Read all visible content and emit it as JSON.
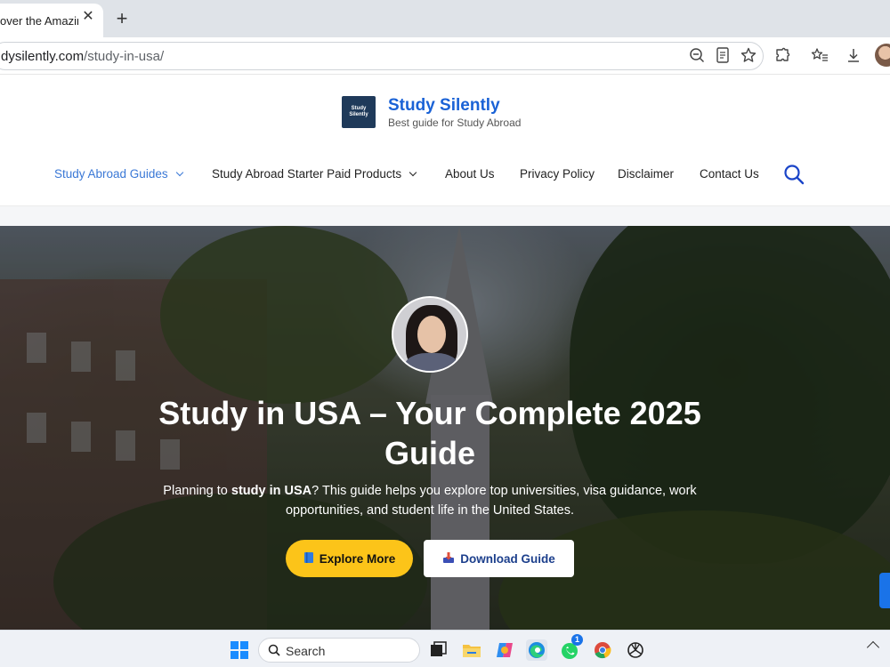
{
  "browser": {
    "tab_title": "over the Amazin",
    "url_domain": "dysilently.com",
    "url_path": "/study-in-usa/"
  },
  "site": {
    "logo_text": [
      "Study",
      "Silently"
    ],
    "title": "Study Silently",
    "tagline": "Best guide for Study Abroad"
  },
  "nav": {
    "items": [
      {
        "label": "Study Abroad Guides",
        "dropdown": true,
        "active": true
      },
      {
        "label": "Study Abroad Starter Paid Products",
        "dropdown": true
      },
      {
        "label": "About Us"
      },
      {
        "label": "Privacy Policy"
      },
      {
        "label": "Disclaimer"
      },
      {
        "label": "Contact Us"
      }
    ]
  },
  "hero": {
    "title": "Study in USA – Your Complete 2025 Guide",
    "subtitle_pre": "Planning to ",
    "subtitle_bold": "study in USA",
    "subtitle_post": "? This guide helps you explore top universities, visa guidance, work opportunities, and student life in the United States.",
    "primary_button": "Explore More",
    "secondary_button": "Download Guide"
  },
  "taskbar": {
    "search_placeholder": "Search",
    "whatsapp_badge": "1"
  },
  "colors": {
    "brand_blue": "#1a62d6",
    "nav_active": "#3a78d6",
    "cta_yellow": "#fcc419",
    "cta_text_blue": "#1c3f8c"
  }
}
